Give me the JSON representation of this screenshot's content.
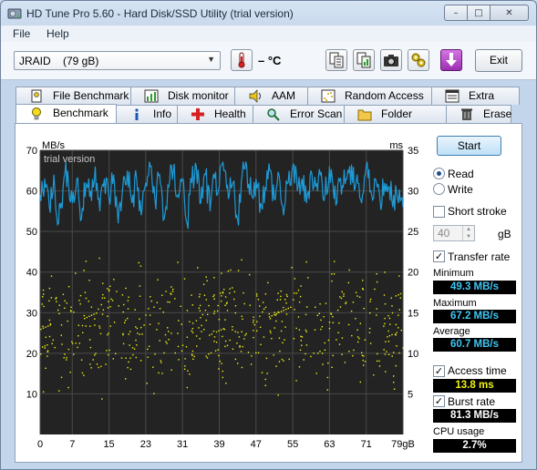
{
  "window": {
    "title": "HD Tune Pro 5.60 - Hard Disk/SSD Utility (trial version)",
    "caption": {
      "minimize": "–",
      "maximize": "□",
      "close": "✕"
    }
  },
  "menu": {
    "file": "File",
    "help": "Help"
  },
  "toolbar": {
    "drive": "JRAID    (79 gB)",
    "temperature": "– °C",
    "exit_label": "Exit"
  },
  "tabs_top": [
    "File Benchmark",
    "Disk monitor",
    "AAM",
    "Random Access",
    "Extra tests"
  ],
  "tabs_bottom": [
    "Benchmark",
    "Info",
    "Health",
    "Error Scan",
    "Folder Usage",
    "Erase"
  ],
  "active_tab": "Benchmark",
  "controls": {
    "start_label": "Start",
    "read_label": "Read",
    "write_label": "Write",
    "mode": "Read",
    "short_stroke_label": "Short stroke",
    "short_stroke_checked": false,
    "short_stroke_value": "40",
    "short_stroke_unit": "gB",
    "transfer_rate_label": "Transfer rate",
    "transfer_rate_checked": true,
    "access_time_label": "Access time",
    "access_time_checked": true,
    "burst_rate_label": "Burst rate",
    "burst_rate_checked": true
  },
  "stats": {
    "minimum_label": "Minimum",
    "minimum": "49.3 MB/s",
    "maximum_label": "Maximum",
    "maximum": "67.2 MB/s",
    "average_label": "Average",
    "average": "60.7 MB/s",
    "access_time": "13.8 ms",
    "burst_rate": "81.3 MB/s",
    "cpu_label": "CPU usage",
    "cpu": "2.7%"
  },
  "colors": {
    "chart_bg": "#232323",
    "grid": "#4a4a4a",
    "transfer_line": "#1e9ad6",
    "access_dots": "#f2f213",
    "value_cyan": "#3fc6f2",
    "value_yellow": "#f2f213",
    "value_white": "#ffffff"
  },
  "chart_data": {
    "type": "line",
    "watermark": "trial version",
    "y_left_label": "MB/s",
    "y_right_label": "ms",
    "y_left_ticks": [
      "70",
      "60",
      "50",
      "40",
      "30",
      "20",
      "10"
    ],
    "y_right_ticks": [
      "35",
      "30",
      "25",
      "20",
      "15",
      "10",
      "5"
    ],
    "x_ticks": [
      "0",
      "7",
      "15",
      "23",
      "31",
      "39",
      "47",
      "55",
      "63",
      "71",
      "79gB"
    ],
    "ylim_left": [
      0,
      70
    ],
    "ylim_right": [
      0,
      35
    ],
    "xlim": [
      0,
      79
    ],
    "grid": true,
    "series": [
      {
        "name": "Transfer rate",
        "unit": "MB/s",
        "x": [
          0,
          1,
          2,
          3,
          4,
          5,
          6,
          7,
          8,
          9,
          10,
          11,
          12,
          13,
          14,
          15,
          16,
          17,
          18,
          19,
          20,
          21,
          22,
          23,
          24,
          25,
          26,
          27,
          28,
          29,
          30,
          31,
          32,
          33,
          34,
          35,
          36,
          37,
          38,
          39,
          40,
          41,
          42,
          43,
          44,
          45,
          46,
          47,
          48,
          49,
          50,
          51,
          52,
          53,
          54,
          55,
          56,
          57,
          58,
          59,
          60,
          61,
          62,
          63,
          64,
          65,
          66,
          67,
          68,
          69,
          70,
          71,
          72,
          73,
          74,
          75,
          76,
          77,
          78,
          79
        ],
        "y": [
          59,
          63,
          56,
          64,
          52,
          61,
          65,
          57,
          63,
          53,
          62,
          60,
          66,
          55,
          63,
          58,
          64,
          52,
          61,
          65,
          57,
          63,
          54,
          62,
          66,
          58,
          64,
          53,
          61,
          65,
          59,
          63,
          52,
          62,
          66,
          57,
          64,
          55,
          63,
          61,
          65,
          58,
          62,
          53,
          64,
          66,
          59,
          63,
          57,
          61,
          65,
          58,
          64,
          54,
          62,
          66,
          60,
          63,
          57,
          65,
          61,
          64,
          59,
          66,
          58,
          63,
          61,
          65,
          62,
          64,
          57,
          66,
          60,
          63,
          58,
          62,
          61,
          59,
          57,
          56
        ]
      },
      {
        "name": "Access time",
        "unit": "ms",
        "type": "scatter",
        "y_range_ms": [
          3.5,
          24
        ],
        "y_typical_ms": 13.8
      }
    ]
  }
}
